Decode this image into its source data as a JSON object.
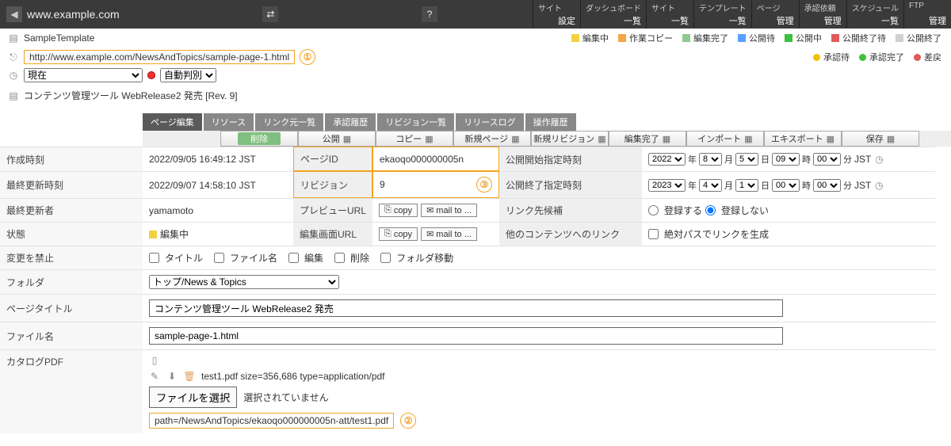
{
  "topbar": {
    "site": "www.example.com",
    "menus": [
      {
        "title": "サイト",
        "action": "設定"
      },
      {
        "title": "ダッシュボード",
        "action": "一覧"
      },
      {
        "title": "サイト",
        "action": "一覧"
      },
      {
        "title": "テンプレート",
        "action": "一覧"
      },
      {
        "title": "ページ",
        "action": "管理"
      },
      {
        "title": "承認依頼",
        "action": "管理"
      },
      {
        "title": "スケジュール",
        "action": "一覧"
      },
      {
        "title": "FTP",
        "action": "管理"
      }
    ]
  },
  "legend1": [
    {
      "color": "#f5d142",
      "label": "編集中"
    },
    {
      "color": "#f5a742",
      "label": "作業コピー"
    },
    {
      "color": "#8fc98f",
      "label": "編集完了"
    },
    {
      "color": "#5aa0ff",
      "label": "公開待"
    },
    {
      "color": "#3cc13c",
      "label": "公開中"
    },
    {
      "color": "#e05a5a",
      "label": "公開終了待"
    },
    {
      "color": "#d0d0d0",
      "label": "公開終了"
    }
  ],
  "legend2": [
    {
      "color": "#f2c200",
      "label": "承認待"
    },
    {
      "color": "#3cc13c",
      "label": "承認完了"
    },
    {
      "color": "#e05a5a",
      "label": "差戻"
    }
  ],
  "template_name": "SampleTemplate",
  "page_url": "http://www.example.com/NewsAndTopics/sample-page-1.html",
  "time_select": "現在",
  "encoding_select": "自動判別",
  "headline": "コンテンツ管理ツール WebRelease2 発売 [Rev. 9]",
  "tabs": [
    "ページ編集",
    "リソース",
    "リンク元一覧",
    "承認履歴",
    "リビジョン一覧",
    "リリースログ",
    "操作履歴"
  ],
  "toolbar": [
    "削除",
    "公開",
    "コピー",
    "新規ページ",
    "新規リビジョン",
    "編集完了",
    "インポート",
    "エキスポート",
    "保存"
  ],
  "labels": {
    "created": "作成時刻",
    "updated": "最終更新時刻",
    "updater": "最終更新者",
    "status": "状態",
    "lock": "変更を禁止",
    "folder": "フォルダ",
    "title": "ページタイトル",
    "filename": "ファイル名",
    "catalog": "カタログPDF",
    "page_id": "ページID",
    "revision": "リビジョン",
    "preview_url": "プレビューURL",
    "edit_url": "編集画面URL",
    "pub_start": "公開開始指定時刻",
    "pub_end": "公開終了指定時刻",
    "link_cand": "リンク先候補",
    "other_link": "他のコンテンツへのリンク"
  },
  "values": {
    "created": "2022/09/05 16:49:12 JST",
    "updated": "2022/09/07 14:58:10 JST",
    "updater": "yamamoto",
    "status": "編集中",
    "page_id": "ekaoqo000000005n",
    "revision": "9",
    "copy_btn": "copy",
    "mail_btn": "mail to ...",
    "tz": "JST"
  },
  "lock_opts": [
    "タイトル",
    "ファイル名",
    "編集",
    "削除",
    "フォルダ移動"
  ],
  "link_opts": {
    "register": "登録する",
    "noregister": "登録しない"
  },
  "abs_path_opt": "絶対パスでリンクを生成",
  "folder_value": "トップ/News & Topics",
  "title_value": "コンテンツ管理ツール WebRelease2 発売",
  "filename_value": "sample-page-1.html",
  "file": {
    "info": "test1.pdf size=356,686 type=application/pdf",
    "choose": "ファイルを選択",
    "none": "選択されていません",
    "path": "path=/NewsAndTopics/ekaoqo000000005n-att/test1.pdf"
  },
  "date_start": {
    "year": "2022",
    "month": "8",
    "day": "5",
    "hour": "09",
    "min": "00"
  },
  "date_end": {
    "year": "2023",
    "month": "4",
    "day": "1",
    "hour": "00",
    "min": "00"
  },
  "date_units": {
    "year": "年",
    "month": "月",
    "day": "日",
    "hour": "時",
    "min": "分"
  },
  "annot": {
    "one": "①",
    "two": "②",
    "three": "③"
  }
}
